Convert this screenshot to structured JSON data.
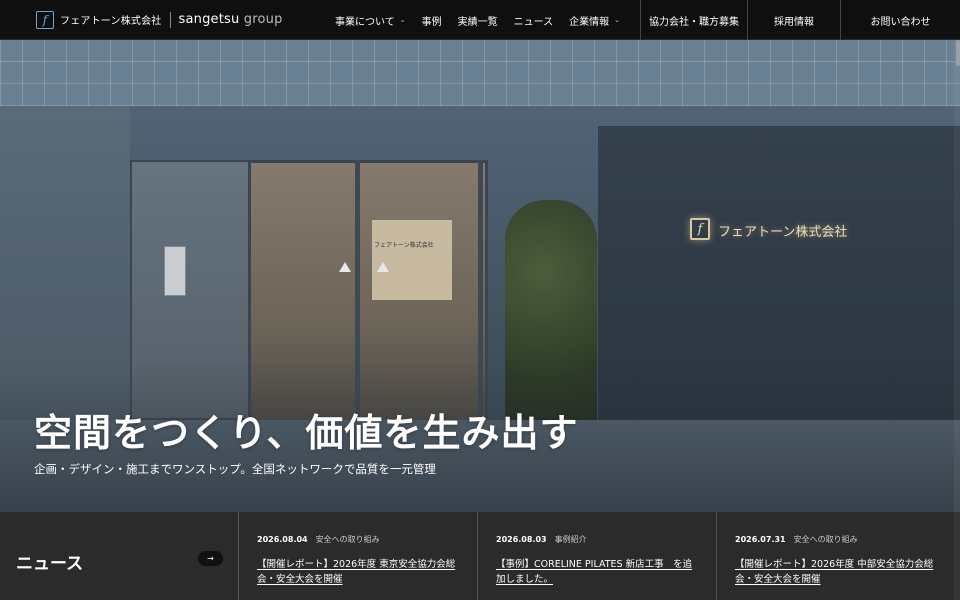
{
  "header": {
    "logo_mark": "f",
    "logo_company": "フェアトーン株式会社",
    "logo_group_brand": "sangetsu",
    "logo_group_word": "group",
    "nav": [
      {
        "label": "事業について",
        "dropdown": true
      },
      {
        "label": "事例",
        "dropdown": false
      },
      {
        "label": "実績一覧",
        "dropdown": false
      },
      {
        "label": "ニュース",
        "dropdown": false
      },
      {
        "label": "企業情報",
        "dropdown": true
      }
    ],
    "nav_right": [
      "協力会社・職方募集",
      "採用情報",
      "お問い合わせ"
    ]
  },
  "hero": {
    "title": "空間をつくり、価値を生み出す",
    "subtitle": "企画・デザイン・施工までワンストップ。全国ネットワークで品質を一元管理",
    "sign_text": "フェアトーン株式会社",
    "inner_sign_text": "フェアトーン株式会社"
  },
  "news": {
    "title": "ニュース",
    "arrow": "→",
    "items": [
      {
        "date": "2026.08.04",
        "category": "安全への取り組み",
        "text": "【開催レポート】2026年度 東京安全協力会総会・安全大会を開催"
      },
      {
        "date": "2026.08.03",
        "category": "事例紹介",
        "text": "【事例】CORELINE PILATES 新店工事　を追加しました。"
      },
      {
        "date": "2026.07.31",
        "category": "安全への取り組み",
        "text": "【開催レポート】2026年度 中部安全協力会総会・安全大会を開催"
      }
    ]
  },
  "colors": {
    "header_bg": "#0f0f10",
    "news_bg": "#2b2b2b",
    "logo_accent": "#6fa6d6",
    "sign_glow": "#eddcb8"
  },
  "icons": [
    "chevron-down-icon",
    "arrow-right-icon"
  ]
}
